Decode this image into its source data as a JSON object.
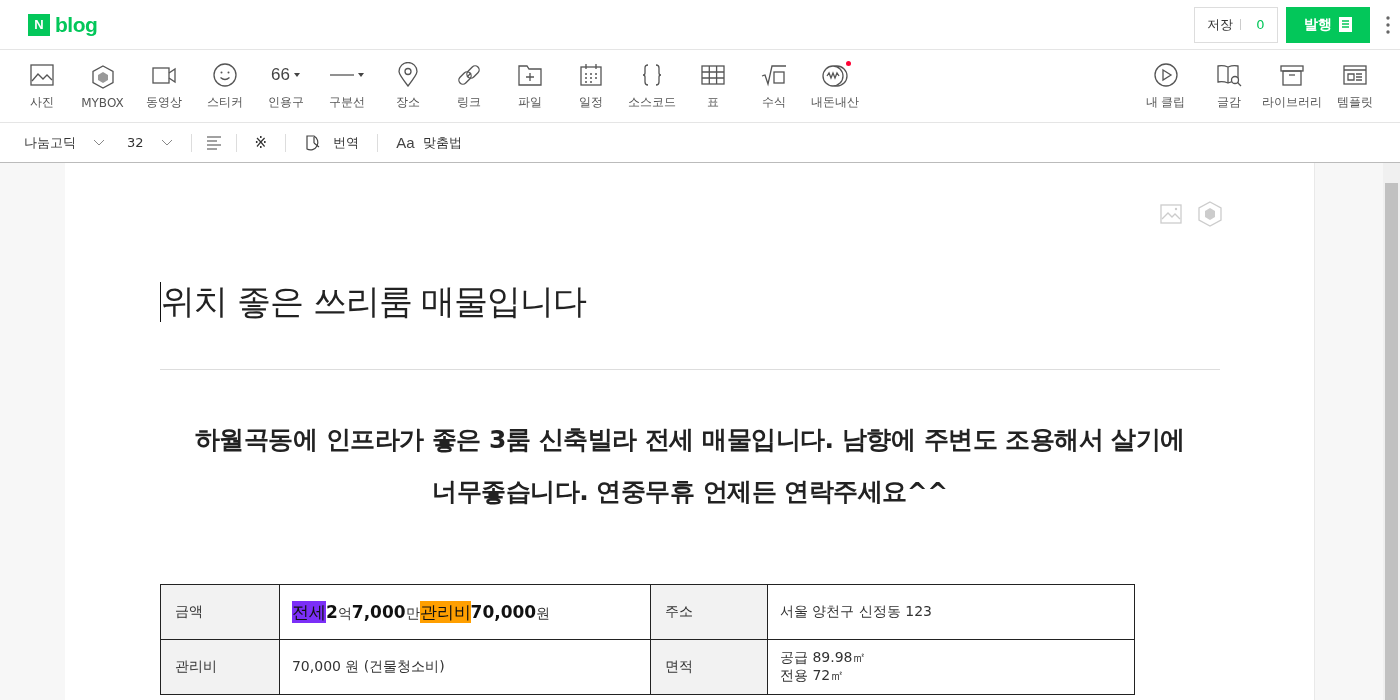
{
  "header": {
    "logo_mark": "N",
    "logo_text": "blog",
    "save": {
      "label": "저장",
      "count": "0"
    },
    "publish": {
      "label": "발행"
    }
  },
  "toolbar": {
    "left": [
      {
        "label": "사진"
      },
      {
        "label": "MYBOX"
      },
      {
        "label": "동영상"
      },
      {
        "label": "스티커"
      },
      {
        "label": "인용구",
        "glyph": "66",
        "dropdown": true
      },
      {
        "label": "구분선",
        "dropdown": true
      },
      {
        "label": "장소"
      },
      {
        "label": "링크"
      },
      {
        "label": "파일"
      },
      {
        "label": "일정"
      },
      {
        "label": "소스코드"
      },
      {
        "label": "표"
      },
      {
        "label": "수식"
      },
      {
        "label": "내돈내산",
        "badge": true
      }
    ],
    "right": [
      {
        "label": "내 클립"
      },
      {
        "label": "글감"
      },
      {
        "label": "라이브러리"
      },
      {
        "label": "템플릿"
      }
    ]
  },
  "format_bar": {
    "font": "나눔고딕",
    "size": "32",
    "symbol": "※",
    "translate": "번역",
    "spelling_glyph": "Aa",
    "spelling": "맞춤법"
  },
  "document": {
    "title": "위치 좋은 쓰리룸 매물입니다",
    "body": "하월곡동에 인프라가 좋은 3룸 신축빌라 전세 매물입니다. 남향에 주변도 조용해서 살기에 너무좋습니다. 연중무휴 언제든 연락주세요^^",
    "table": {
      "rows": [
        [
          {
            "kind": "head",
            "lines": [
              "금액"
            ]
          },
          {
            "kind": "rich",
            "segments": [
              {
                "kind": "highlight",
                "text": "전세",
                "color": "#7b2ff7"
              },
              {
                "kind": "bold",
                "text": "2"
              },
              {
                "kind": "plain",
                "text": "억"
              },
              {
                "kind": "bold",
                "text": "7,000"
              },
              {
                "kind": "plain",
                "text": "만"
              },
              {
                "kind": "highlight",
                "text": "관리비",
                "color": "#ff9f00"
              },
              {
                "kind": "bold",
                "text": "70,000"
              },
              {
                "kind": "plain",
                "text": "원"
              }
            ]
          },
          {
            "kind": "head",
            "lines": [
              "주소"
            ]
          },
          {
            "kind": "text",
            "lines": [
              "서울 양천구 신정동 123"
            ]
          }
        ],
        [
          {
            "kind": "head",
            "lines": [
              "관리비"
            ]
          },
          {
            "kind": "text",
            "lines": [
              "70,000 원 (건물청소비)"
            ]
          },
          {
            "kind": "head",
            "lines": [
              "면적"
            ]
          },
          {
            "kind": "text",
            "lines": [
              "공급 89.98㎡",
              "전용 72㎡"
            ]
          }
        ]
      ]
    }
  }
}
